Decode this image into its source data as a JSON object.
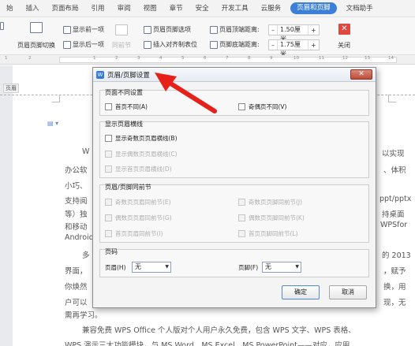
{
  "menubar": {
    "items": [
      "始",
      "插入",
      "页面布局",
      "引用",
      "审阅",
      "视图",
      "章节",
      "安全",
      "开发工具",
      "云服务",
      "页眉和页脚",
      "文档助手"
    ],
    "active_index": 10
  },
  "toolbar": {
    "header_footer_switch": "页眉页脚切换",
    "show_prev": "显示前一项",
    "show_next": "显示后一项",
    "same_as_prev": "同前节",
    "hf_options": "页眉页脚选项",
    "insert_align_tab": "插入对齐制表位",
    "header_top_label": "页眉顶端距离:",
    "header_top_value": "1.50厘米",
    "footer_bottom_label": "页脚底端距离:",
    "footer_bottom_value": "1.75厘米",
    "minus": "–",
    "plus": "+",
    "close_label": "关闭",
    "close_glyph": "✕"
  },
  "ruler": {
    "ticks": [
      "1",
      "2",
      "1",
      "2",
      "3",
      "4",
      "5",
      "6",
      "7",
      "8",
      "9",
      "10",
      "11",
      "12",
      "13",
      "14"
    ]
  },
  "document": {
    "header_tag": "页眉",
    "lines": [
      {
        "left": "W",
        "right": "以实现"
      },
      {
        "left": "办公软",
        "right": "、体积"
      },
      {
        "left": "小巧、",
        "right": ""
      },
      {
        "left": "支持阅",
        "right": "ppt/pptx"
      },
      {
        "left": "等）独",
        "right": "持桌面"
      },
      {
        "left": "和移动",
        "right": "WPSfor"
      },
      {
        "left": "Android",
        "right": ""
      },
      {
        "left": "多",
        "right": "的 2013"
      },
      {
        "left": "界面，",
        "right": "，赋予"
      },
      {
        "left": "你焕然",
        "right": "换，用"
      },
      {
        "left": "户可以",
        "right": "现，无"
      }
    ],
    "line_need": "需再学习。",
    "line_free": "兼容免费 WPS Office 个人版对个人用户永久免费，包含 WPS 文字、WPS 表格、",
    "line_last": "WPS 演示三大功能模块，与 MS Word、MS Excel、MS PowerPoint——对应，应用"
  },
  "dialog": {
    "title": "页眉/页脚设置",
    "app_icon": "W",
    "close_glyph": "✕",
    "sections": {
      "different_pages": {
        "title": "页面不同设置",
        "first_page": "首页不同(A)",
        "odd_even": "奇偶页不同(V)"
      },
      "header_line": {
        "title": "显示页眉横线",
        "odd": "显示奇数页页眉横线(B)",
        "even": "显示偶数页页眉横线(C)",
        "first": "显示首页页眉横线(D)"
      },
      "same_as_prev": {
        "title": "页眉/页脚同前节",
        "odd_header": "奇数页页眉同前节(E)",
        "odd_footer": "奇数页页脚同前节(J)",
        "even_header": "偶数页页眉同前节(G)",
        "even_footer": "偶数页页脚同前节(K)",
        "first_header": "首页页眉同前节(I)",
        "first_footer": "首页页脚同前节(L)"
      },
      "page_number": {
        "title": "页码",
        "header_label": "页眉(H)",
        "header_value": "无",
        "footer_label": "页脚(F)",
        "footer_value": "无"
      }
    },
    "ok": "确定",
    "cancel": "取消"
  },
  "colors": {
    "accent": "#3b7fd9",
    "arrow": "#e8201a",
    "close": "#e0473e"
  }
}
